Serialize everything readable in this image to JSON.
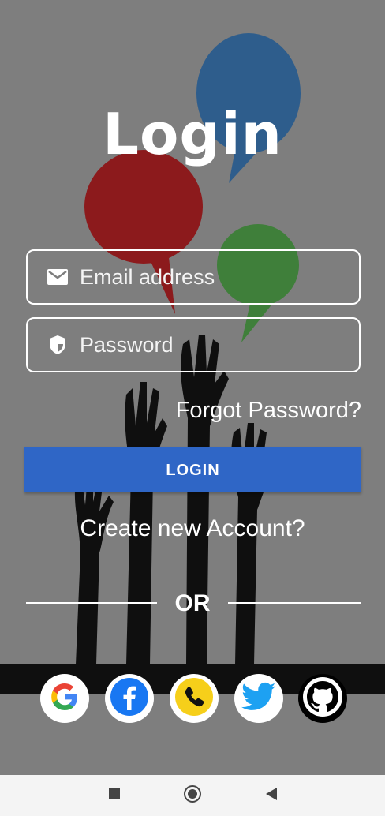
{
  "title": "Login",
  "email_field": {
    "placeholder": "Email address",
    "icon": "mail-icon"
  },
  "password_field": {
    "placeholder": "Password",
    "icon": "shield-icon"
  },
  "forgot_password": "Forgot Password?",
  "login_button": "LOGIN",
  "create_account": "Create new Account?",
  "divider_text": "OR",
  "social_buttons": [
    "google-icon",
    "facebook-icon",
    "phone-icon",
    "twitter-icon",
    "github-icon"
  ],
  "colors": {
    "background": "#7e7e7e",
    "button": "#2f66c6",
    "bubble_blue": "#2e5d8c",
    "bubble_red": "#8c1a1c",
    "bubble_green": "#3f7f3a",
    "phone_yellow": "#f6cf1a"
  },
  "navbar": {
    "buttons": [
      "recents-square-icon",
      "home-circle-icon",
      "back-triangle-icon"
    ]
  }
}
